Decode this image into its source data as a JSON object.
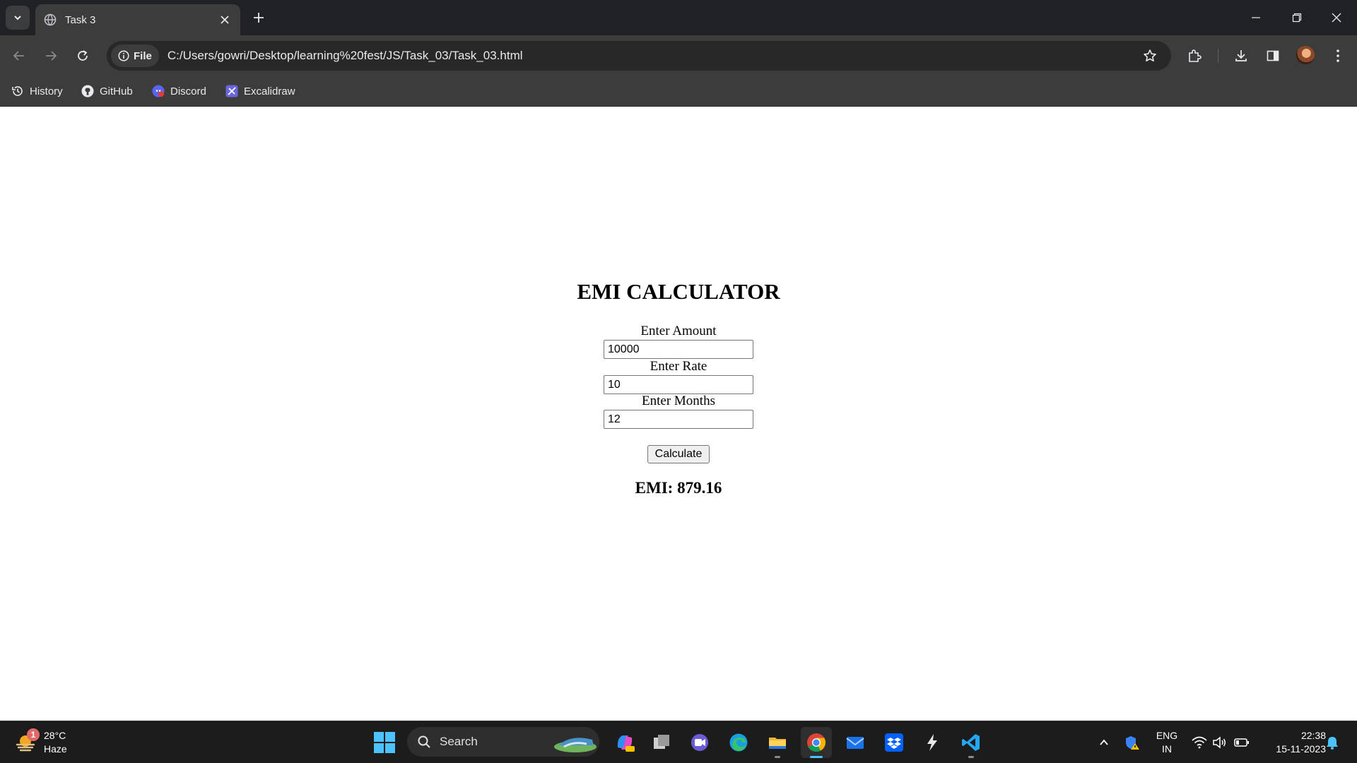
{
  "browser": {
    "tab_title": "Task 3",
    "site_chip_label": "File",
    "url": "C:/Users/gowri/Desktop/learning%20fest/JS/Task_03/Task_03.html",
    "bookmarks": [
      {
        "label": "History",
        "icon": "history-icon"
      },
      {
        "label": "GitHub",
        "icon": "github-icon"
      },
      {
        "label": "Discord",
        "icon": "discord-icon"
      },
      {
        "label": "Excalidraw",
        "icon": "excalidraw-icon"
      }
    ]
  },
  "calculator": {
    "title": "EMI CALCULATOR",
    "amount_label": "Enter Amount",
    "amount_value": "10000",
    "rate_label": "Enter Rate",
    "rate_value": "10",
    "months_label": "Enter Months",
    "months_value": "12",
    "button_label": "Calculate",
    "result": "EMI: 879.16"
  },
  "taskbar": {
    "weather_temp": "28°C",
    "weather_desc": "Haze",
    "weather_badge": "1",
    "search_label": "Search",
    "language_line1": "ENG",
    "language_line2": "IN",
    "time": "22:38",
    "date": "15-11-2023"
  },
  "colors": {
    "titlebar": "#202124",
    "toolbar": "#3c3c3c",
    "taskbar": "#1c1c1c",
    "page_background": "#ffffff"
  }
}
